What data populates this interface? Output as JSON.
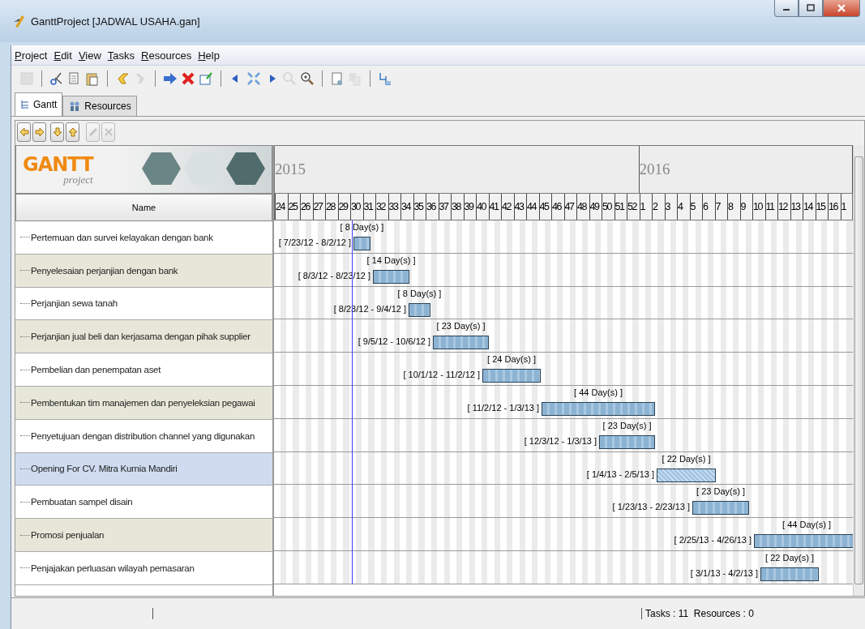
{
  "window": {
    "title": "GanttProject [JADWAL USAHA.gan]"
  },
  "menu": [
    "Project",
    "Edit",
    "View",
    "Tasks",
    "Resources",
    "Help"
  ],
  "tabs": [
    {
      "label": "Gantt",
      "selected": true
    },
    {
      "label": "Resources",
      "selected": false
    }
  ],
  "logo": {
    "title": "GANTT",
    "subtitle": "project"
  },
  "timeline": {
    "years": [
      "2015",
      "2016"
    ],
    "weeks": [
      "24",
      "25",
      "26",
      "27",
      "28",
      "29",
      "30",
      "31",
      "32",
      "33",
      "34",
      "35",
      "36",
      "37",
      "38",
      "39",
      "40",
      "41",
      "42",
      "43",
      "44",
      "45",
      "46",
      "47",
      "48",
      "49",
      "50",
      "51",
      "52",
      "1",
      "2",
      "3",
      "4",
      "5",
      "6",
      "7",
      "8",
      "9",
      "10",
      "11",
      "12",
      "13",
      "14",
      "15",
      "16",
      "1"
    ]
  },
  "table": {
    "column": "Name",
    "tasks": [
      {
        "name": "Pertemuan dan survei kelayakan dengan bank",
        "dates": "[ 7/23/12 - 8/2/12 ]",
        "duration": "[ 8 Day(s) ]",
        "selected": false
      },
      {
        "name": "Penyelesaian perjanjian dengan bank",
        "dates": "[ 8/3/12 - 8/23/12 ]",
        "duration": "[ 14 Day(s) ]",
        "selected": false
      },
      {
        "name": "Perjanjian sewa tanah",
        "dates": "[ 8/23/12 - 9/4/12 ]",
        "duration": "[ 8 Day(s) ]",
        "selected": false
      },
      {
        "name": "Perjanjian jual beli dan kerjasama dengan pihak supplier",
        "dates": "[ 9/5/12 - 10/6/12 ]",
        "duration": "[ 23 Day(s) ]",
        "selected": false
      },
      {
        "name": "Pembelian dan penempatan aset",
        "dates": "[ 10/1/12 - 11/2/12 ]",
        "duration": "[ 24 Day(s) ]",
        "selected": false
      },
      {
        "name": "Pembentukan tim manajemen dan penyeleksian pegawai",
        "dates": "[ 11/2/12 - 1/3/13 ]",
        "duration": "[ 44 Day(s) ]",
        "selected": false
      },
      {
        "name": "Penyetujuan dengan distribution channel yang digunakan",
        "dates": "[ 12/3/12 - 1/3/13 ]",
        "duration": "[ 23 Day(s) ]",
        "selected": false
      },
      {
        "name": "Opening For CV. Mitra Kurnia Mandiri",
        "dates": "[ 1/4/13 - 2/5/13 ]",
        "duration": "[ 22 Day(s) ]",
        "selected": true
      },
      {
        "name": "Pembuatan sampel disain",
        "dates": "[ 1/23/13 - 2/23/13 ]",
        "duration": "[ 23 Day(s) ]",
        "selected": false
      },
      {
        "name": "Promosi penjualan",
        "dates": "[ 2/25/13 - 4/26/13 ]",
        "duration": "[ 44 Day(s) ]",
        "selected": false
      },
      {
        "name": "Penjajakan perluasan wilayah pemasaran",
        "dates": "[ 3/1/13 - 4/2/13 ]",
        "duration": "[ 22 Day(s) ]",
        "selected": false
      }
    ]
  },
  "status_bar": {
    "counts": "Tasks : 11  Resources : 0"
  }
}
